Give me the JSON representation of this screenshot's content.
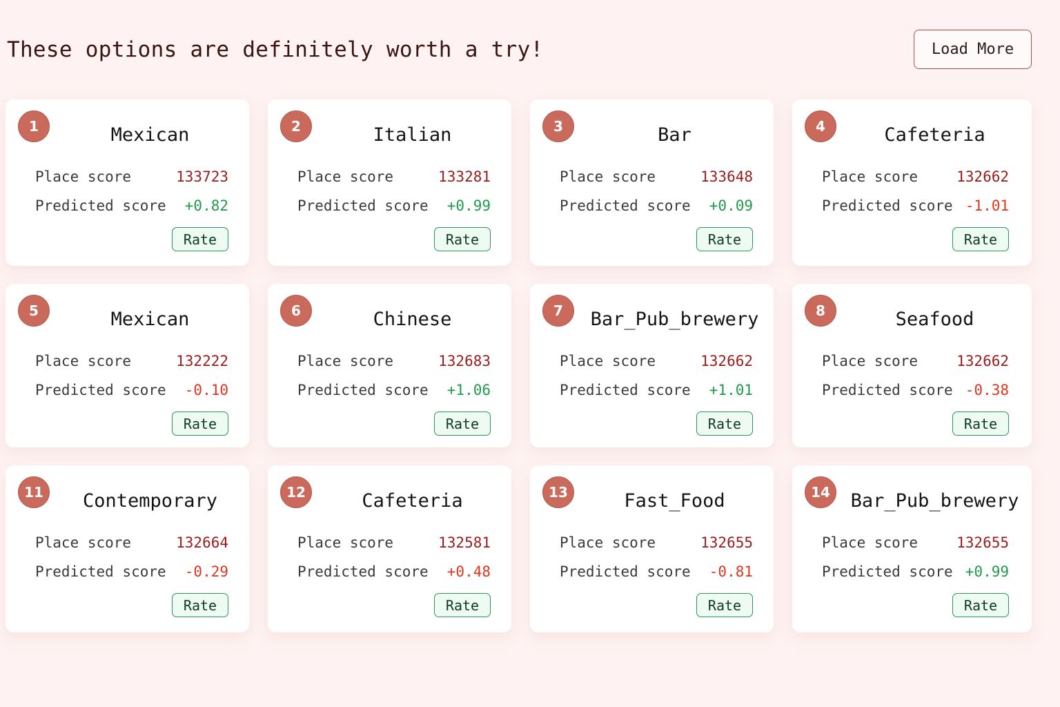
{
  "header": {
    "title": "These options are definitely worth a try!",
    "load_more_label": "Load More"
  },
  "labels": {
    "place_score": "Place score",
    "predicted_score": "Predicted score",
    "rate": "Rate"
  },
  "colors": {
    "page_background": "#fef3f2",
    "badge": "#c96a5d",
    "place_score": "#9a1b1b",
    "positive": "#1f9a4a",
    "negative": "#e0341f",
    "rate_border": "#2f9460"
  },
  "cards": [
    {
      "rank": "1",
      "name": "Mexican",
      "place_score": "133723",
      "predicted_score": "+0.82",
      "sign": "pos"
    },
    {
      "rank": "2",
      "name": "Italian",
      "place_score": "133281",
      "predicted_score": "+0.99",
      "sign": "pos"
    },
    {
      "rank": "3",
      "name": "Bar",
      "place_score": "133648",
      "predicted_score": "+0.09",
      "sign": "pos"
    },
    {
      "rank": "4",
      "name": "Cafeteria",
      "place_score": "132662",
      "predicted_score": "-1.01",
      "sign": "neg"
    },
    {
      "rank": "5",
      "name": "Mexican",
      "place_score": "132222",
      "predicted_score": "-0.10",
      "sign": "neg"
    },
    {
      "rank": "6",
      "name": "Chinese",
      "place_score": "132683",
      "predicted_score": "+1.06",
      "sign": "pos"
    },
    {
      "rank": "7",
      "name": "Bar_Pub_brewery",
      "place_score": "132662",
      "predicted_score": "+1.01",
      "sign": "pos"
    },
    {
      "rank": "8",
      "name": "Seafood",
      "place_score": "132662",
      "predicted_score": "-0.38",
      "sign": "neg"
    },
    {
      "rank": "11",
      "name": "Contemporary",
      "place_score": "132664",
      "predicted_score": "-0.29",
      "sign": "neg"
    },
    {
      "rank": "12",
      "name": "Cafeteria",
      "place_score": "132581",
      "predicted_score": "+0.48",
      "sign": "neg"
    },
    {
      "rank": "13",
      "name": "Fast_Food",
      "place_score": "132655",
      "predicted_score": "-0.81",
      "sign": "neg"
    },
    {
      "rank": "14",
      "name": "Bar_Pub_brewery",
      "place_score": "132655",
      "predicted_score": "+0.99",
      "sign": "pos"
    }
  ]
}
